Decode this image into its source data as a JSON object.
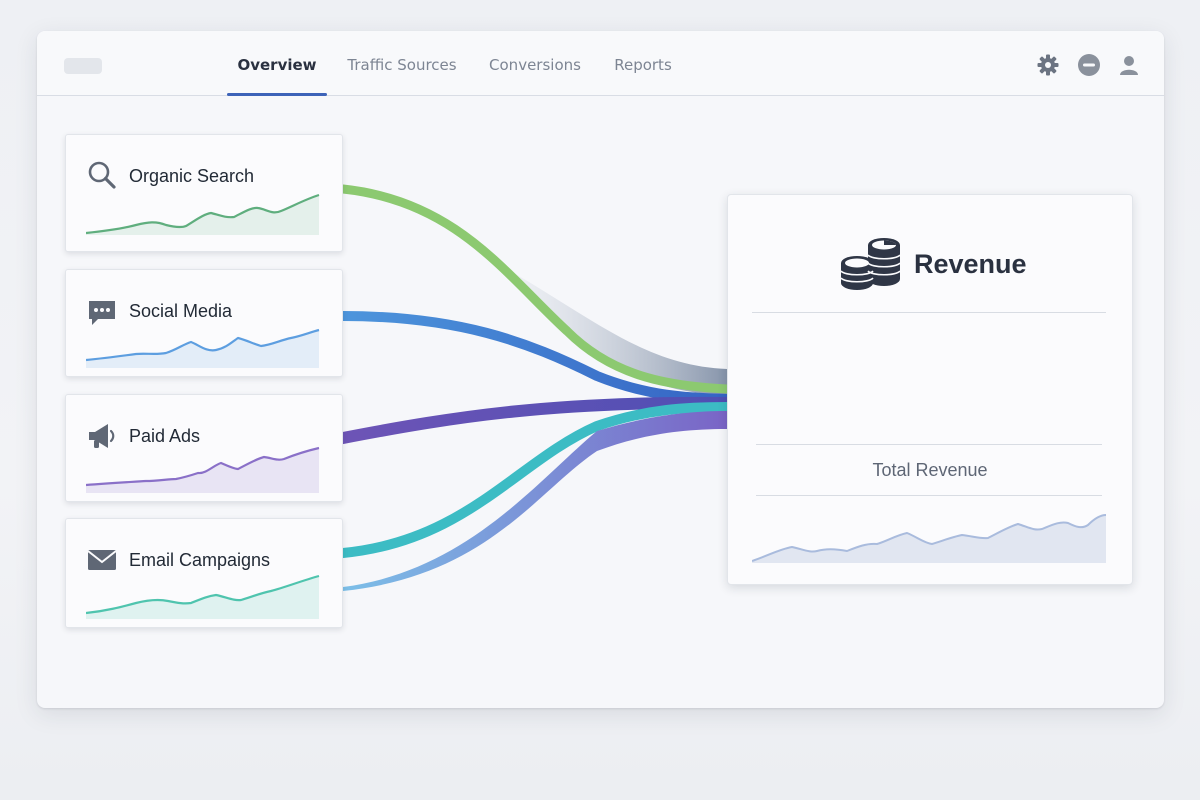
{
  "nav": {
    "tabs": [
      {
        "label": "Overview",
        "active": true
      },
      {
        "label": "Traffic Sources",
        "active": false
      },
      {
        "label": "Conversions",
        "active": false
      },
      {
        "label": "Reports",
        "active": false
      }
    ],
    "icons": [
      "gear-icon",
      "minus-circle-icon",
      "user-icon"
    ]
  },
  "sources": [
    {
      "label": "Organic Search",
      "icon": "search-icon",
      "color": "#5fae7e",
      "flow_color": "#8cc970"
    },
    {
      "label": "Social Media",
      "icon": "chat-bubble-icon",
      "color": "#5d9ee0",
      "flow_color": "#4d95dc"
    },
    {
      "label": "Paid Ads",
      "icon": "megaphone-icon",
      "color": "#8a70c8",
      "flow_color": "#6c56b8"
    },
    {
      "label": "Email Campaigns",
      "icon": "envelope-icon",
      "color": "#4fc4ae",
      "flow_color": "#3cbcc4"
    }
  ],
  "revenue": {
    "title": "Revenue",
    "icon": "coins-icon",
    "total_label": "Total Revenue"
  },
  "colors": {
    "accent": "#3d63b8",
    "text_dark": "#2a3140",
    "text_muted": "#7d8593"
  }
}
